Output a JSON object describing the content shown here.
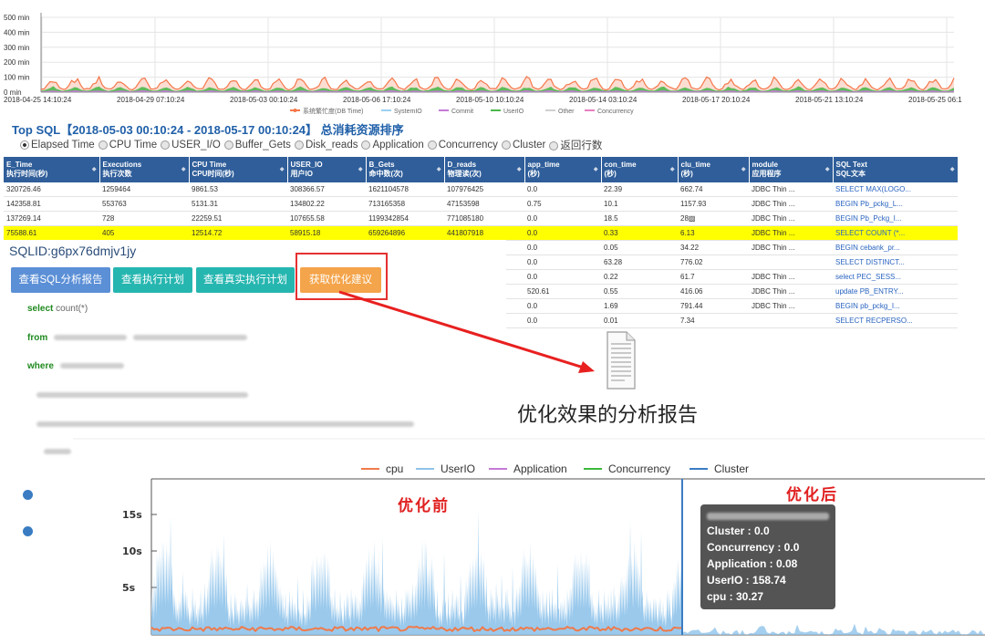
{
  "top_chart": {
    "y_ticks": [
      "500 min",
      "400 min",
      "300 min",
      "200 min",
      "100 min",
      "0 min"
    ],
    "x_ticks": [
      "2018-04-25 14:10:24",
      "2018-04-29 07:10:24",
      "2018-05-03 00:10:24",
      "2018-05-06 17:10:24",
      "2018-05-10 10:10:24",
      "2018-05-14 03:10:24",
      "2018-05-17 20:10:24",
      "2018-05-21 13:10:24",
      "2018-05-25 06:1"
    ],
    "legend": [
      "系统繁忙度(DB Time)",
      "SystemIO",
      "Commit",
      "UserIO",
      "Other",
      "Concurrency"
    ],
    "colors": {
      "db_time": "#f4784b",
      "systemio": "#9bd1f0",
      "commit": "#c57ad8",
      "userio": "#4cb84c",
      "other": "#d0d0d0",
      "concurrency": "#e77fbf"
    }
  },
  "topsql": {
    "title": "Top SQL【2018-05-03 00:10:24 - 2018-05-17 00:10:24】 总消耗资源排序",
    "radios": [
      "Elapsed Time",
      "CPU Time",
      "USER_I/O",
      "Buffer_Gets",
      "Disk_reads",
      "Application",
      "Concurrency",
      "Cluster",
      "返回行数"
    ],
    "columns": [
      {
        "l1": "E_Time",
        "l2": "执行时间(秒)"
      },
      {
        "l1": "Executions",
        "l2": "执行次数"
      },
      {
        "l1": "CPU Time",
        "l2": "CPU时间(秒)"
      },
      {
        "l1": "USER_IO",
        "l2": "用户IO"
      },
      {
        "l1": "B_Gets",
        "l2": "命中数(次)"
      },
      {
        "l1": "D_reads",
        "l2": "物理读(次)"
      },
      {
        "l1": "app_time",
        "l2": "(秒)"
      },
      {
        "l1": "con_time",
        "l2": "(秒)"
      },
      {
        "l1": "clu_time",
        "l2": "(秒)"
      },
      {
        "l1": "module",
        "l2": "应用程序"
      },
      {
        "l1": "SQL Text",
        "l2": "SQL文本"
      }
    ],
    "rows": [
      [
        "320726.46",
        "1259464",
        "9861.53",
        "308366.57",
        "1621104578",
        "107976425",
        "0.0",
        "22.39",
        "662.74",
        "JDBC Thin ...",
        "SELECT MAX(LOGO..."
      ],
      [
        "142358.81",
        "553763",
        "5131.31",
        "134802.22",
        "713165358",
        "47153598",
        "0.75",
        "10.1",
        "1157.93",
        "JDBC Thin ...",
        "BEGIN Pb_pckg_L..."
      ],
      [
        "137269.14",
        "728",
        "22259.51",
        "107655.58",
        "1199342854",
        "771085180",
        "0.0",
        "18.5",
        "28▨",
        "JDBC Thin ...",
        "BEGIN Pb_Pckg_I..."
      ],
      [
        "75588.61",
        "405",
        "12514.72",
        "58915.18",
        "659264896",
        "441807918",
        "0.0",
        "0.33",
        "6.13",
        "JDBC Thin ...",
        "SELECT COUNT (*..."
      ],
      [
        "",
        "",
        "",
        "",
        "",
        "",
        "0.0",
        "0.05",
        "34.22",
        "JDBC Thin ...",
        "BEGIN cebank_pr..."
      ],
      [
        "",
        "",
        "",
        "",
        "",
        "",
        "0.0",
        "63.28",
        "776.02",
        "",
        "SELECT DISTINCT..."
      ],
      [
        "",
        "",
        "",
        "",
        "",
        "",
        "0.0",
        "0.22",
        "61.7",
        "JDBC Thin ...",
        "select PEC_SESS..."
      ],
      [
        "",
        "",
        "",
        "",
        "",
        "",
        "520.61",
        "0.55",
        "416.06",
        "JDBC Thin ...",
        "update PB_ENTRY..."
      ],
      [
        "",
        "",
        "",
        "",
        "",
        "",
        "0.0",
        "1.69",
        "791.44",
        "JDBC Thin ...",
        "BEGIN pb_pckg_I..."
      ],
      [
        "",
        "",
        "",
        "",
        "",
        "",
        "0.0",
        "0.01",
        "7.34",
        "",
        "SELECT RECPERSO..."
      ]
    ]
  },
  "detail": {
    "sqlid": "SQLID:g6px76dmjv1jy",
    "buttons": [
      "查看SQL分析报告",
      "查看执行计划",
      "查看真实执行计划",
      "获取优化建议"
    ],
    "code_select": "select",
    "code_count": "count(*)",
    "code_from": "from",
    "code_where": "where"
  },
  "report_caption": "优化效果的分析报告",
  "bottom_chart": {
    "legend": [
      "cpu",
      "UserIO",
      "Application",
      "Concurrency",
      "Cluster"
    ],
    "colors": {
      "cpu": "#ef7a4a",
      "userio": "#8fc3ea",
      "application": "#c57ad8",
      "concurrency": "#3db83d",
      "cluster": "#3a7cc2"
    },
    "y_ticks": [
      "15s",
      "10s",
      "5s"
    ],
    "before_label": "优化前",
    "after_label": "优化后",
    "tooltip": {
      "cluster": "Cluster : 0.0",
      "concurrency": "Concurrency : 0.0",
      "application": "Application : 0.08",
      "userio": "UserIO : 158.74",
      "cpu": "cpu : 30.27"
    }
  }
}
